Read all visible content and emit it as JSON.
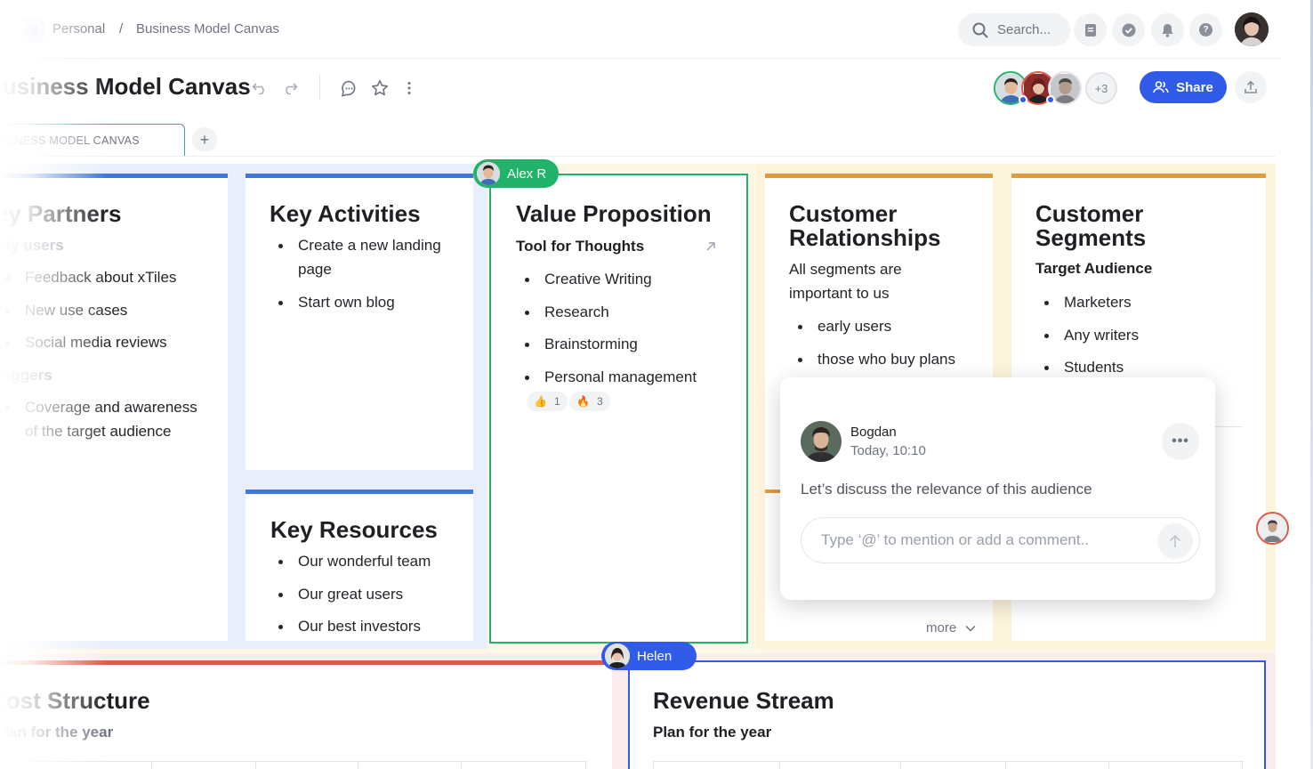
{
  "breadcrumb": {
    "workspace": "Personal",
    "separator": "/",
    "page": "Business Model Canvas"
  },
  "search": {
    "placeholder": "Search..."
  },
  "header_icons": [
    "doc-icon",
    "check-circle-icon",
    "bell-icon",
    "help-icon"
  ],
  "document": {
    "title": "Business Model Canvas"
  },
  "collaborators": {
    "extra_count": "+3"
  },
  "share": {
    "label": "Share"
  },
  "tabs": [
    {
      "label": "BUSINESS MODEL CANVAS"
    }
  ],
  "colors": {
    "accent": "#2f5be8",
    "green": "#22b36b",
    "blue_section": "#3f78dc",
    "orange_section": "#e09a3a",
    "red_section": "#e05a4a"
  },
  "sections": {
    "key_partners": {
      "title": "Key Partners",
      "groups": [
        {
          "label": "Early users",
          "items": [
            "Feedback about xTiles",
            "New use cases",
            "Social media reviews"
          ]
        },
        {
          "label": "Bloggers",
          "items": [
            "Coverage and awareness of the target audience"
          ]
        }
      ]
    },
    "key_activities": {
      "title": "Key Activities",
      "items": [
        "Create a new landing page",
        "Start own blog"
      ]
    },
    "key_resources": {
      "title": "Key Resources",
      "items": [
        "Our wonderful team",
        "Our great users",
        "Our best investors"
      ]
    },
    "value_proposition": {
      "title": "Value Proposition",
      "subtitle": "Tool for Thoughts",
      "items": [
        "Creative Writing",
        "Research",
        "Brainstorming",
        "Personal management"
      ],
      "reactions": [
        {
          "emoji": "👍",
          "count": "1"
        },
        {
          "emoji": "🔥",
          "count": "3"
        }
      ]
    },
    "customer_relationships": {
      "title": "Customer Relationships",
      "text": "All segments are important to us",
      "items": [
        "early users",
        "those who buy plans"
      ],
      "more": "more"
    },
    "customer_segments": {
      "title": "Customer Segments",
      "subtitle": "Target Audience",
      "items": [
        "Marketers",
        "Any writers",
        "Students"
      ]
    },
    "cost_structure": {
      "title": "Cost Structure",
      "subtitle": "Plan for the year"
    },
    "revenue_stream": {
      "title": "Revenue Stream",
      "subtitle": "Plan for the year"
    }
  },
  "cursors": {
    "alex": "Alex R",
    "helen": "Helen"
  },
  "comment": {
    "author": "Bogdan",
    "time": "Today, 10:10",
    "message": "Let’s discuss the relevance of this audience",
    "input_placeholder": "Type ‘@’ to mention or add a comment.."
  }
}
